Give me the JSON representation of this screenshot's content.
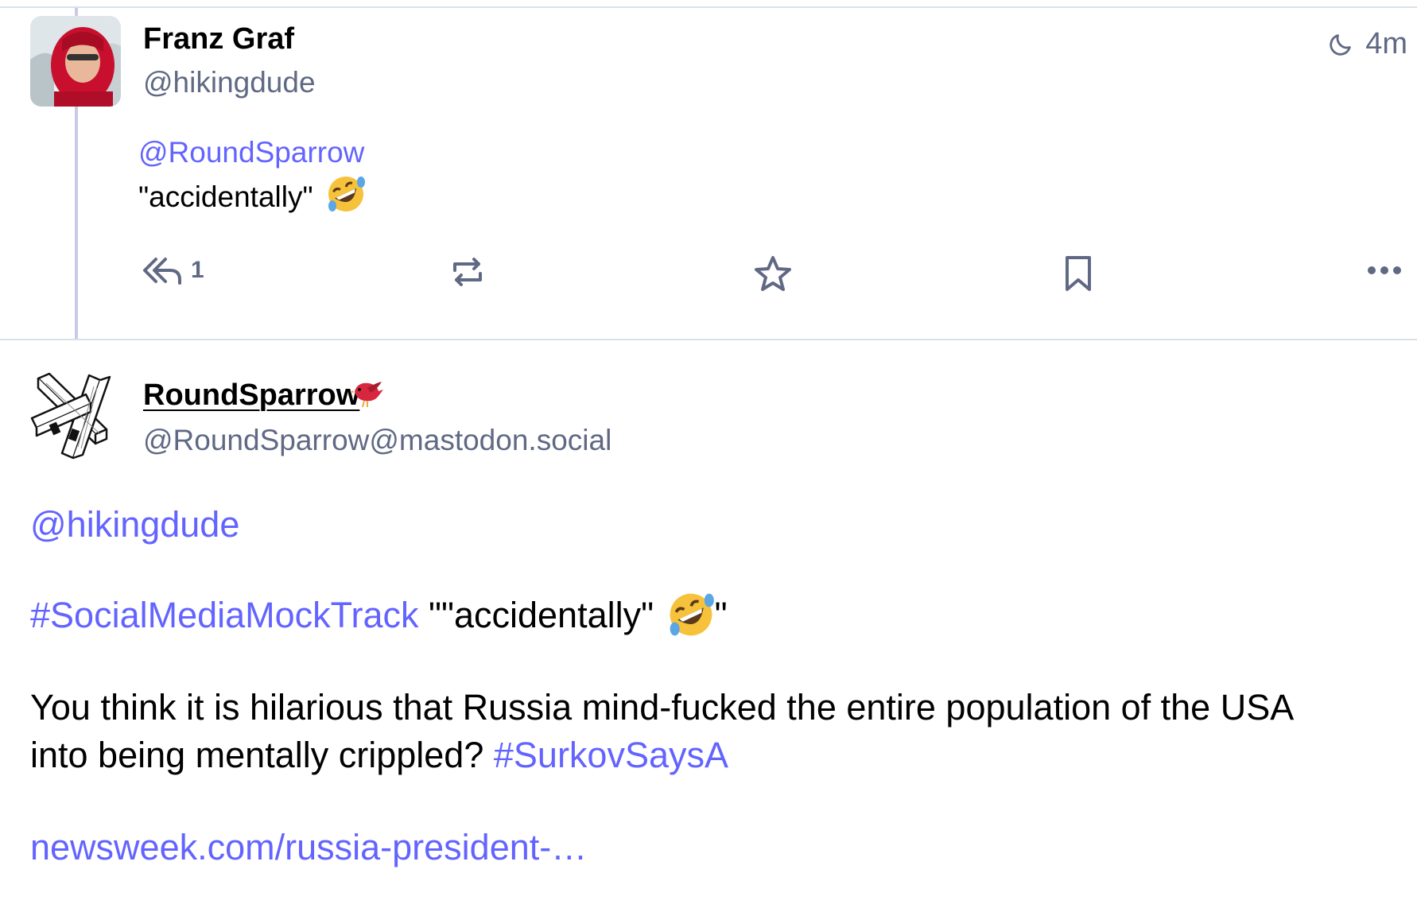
{
  "reply_post": {
    "display_name": "Franz Graf",
    "handle": "@hikingdude",
    "time_ago": "4m",
    "visibility_icon": "moon-icon",
    "mention": "@RoundSparrow",
    "text": "\"accidentally\"",
    "emoji": "rolling-on-the-floor-laughing",
    "reply_count": "1",
    "actions": [
      "reply-icon",
      "boost-icon",
      "favourite-icon",
      "bookmark-icon",
      "more-icon"
    ]
  },
  "original_post": {
    "display_name": "RoundSparrow",
    "name_emoji": "bird",
    "handle": "@RoundSparrow@mastodon.social",
    "mention": "@hikingdude",
    "hashtag1": "#SocialMediaMockTrack",
    "line2_text": "\"\"accidentally\"",
    "line2_end": "\"",
    "line3_a": "You think it is hilarious that Russia mind-fucked the entire population of the USA",
    "line3_b": "into being mentally crippled?",
    "hashtag2": "#SurkovSaysA",
    "link": "newsweek.com/russia-president-…"
  },
  "colors": {
    "accent": "#6364ff",
    "muted": "#606984",
    "thread_line": "#c9cbe6"
  }
}
